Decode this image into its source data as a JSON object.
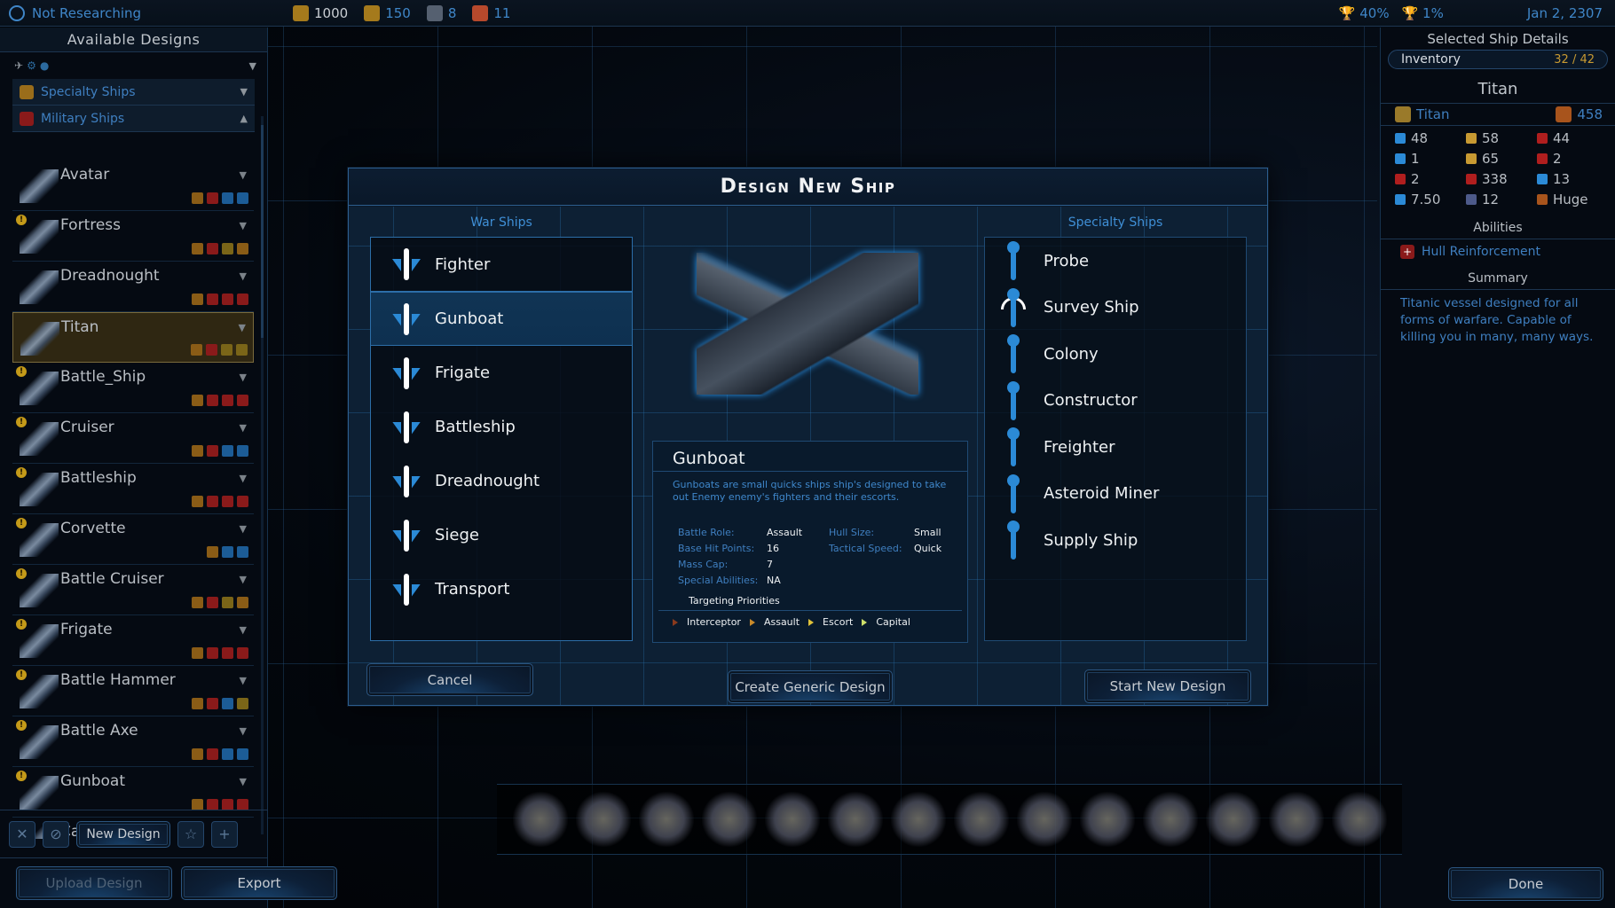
{
  "topbar": {
    "research_status": "Not Researching",
    "resources": [
      {
        "icon": "credits-icon",
        "value": "1000",
        "color": "#a57a1c"
      },
      {
        "icon": "influence-icon",
        "value": "150",
        "color": "#a57a1c"
      },
      {
        "icon": "food-icon",
        "value": "8",
        "color": "#556070"
      },
      {
        "icon": "military-icon",
        "value": "11",
        "color": "#b7492c"
      }
    ],
    "approval": "40%",
    "victory": "1%",
    "date": "Jan 2, 2307"
  },
  "left_panel": {
    "title": "Available Designs",
    "categories": [
      {
        "label": "Specialty Ships",
        "expanded": false
      },
      {
        "label": "Military Ships",
        "expanded": true
      }
    ],
    "designs": [
      {
        "name": "Avatar",
        "warning": false,
        "selected": false,
        "badges": [
          "o",
          "r",
          "b",
          "b"
        ]
      },
      {
        "name": "Fortress",
        "warning": true,
        "selected": false,
        "badges": [
          "o",
          "r",
          "g",
          "o"
        ]
      },
      {
        "name": "Dreadnought",
        "warning": false,
        "selected": false,
        "badges": [
          "o",
          "r",
          "r",
          "r"
        ]
      },
      {
        "name": "Titan",
        "warning": false,
        "selected": true,
        "badges": [
          "o",
          "r",
          "g",
          "g"
        ]
      },
      {
        "name": "Battle_Ship",
        "warning": true,
        "selected": false,
        "badges": [
          "o",
          "r",
          "r",
          "r"
        ]
      },
      {
        "name": "Cruiser",
        "warning": true,
        "selected": false,
        "badges": [
          "o",
          "r",
          "b",
          "b"
        ]
      },
      {
        "name": "Battleship",
        "warning": true,
        "selected": false,
        "badges": [
          "o",
          "r",
          "r",
          "r"
        ]
      },
      {
        "name": "Corvette",
        "warning": true,
        "selected": false,
        "badges": [
          "o",
          "b",
          "b"
        ]
      },
      {
        "name": "Battle Cruiser",
        "warning": true,
        "selected": false,
        "badges": [
          "o",
          "r",
          "g",
          "o"
        ]
      },
      {
        "name": "Frigate",
        "warning": true,
        "selected": false,
        "badges": [
          "o",
          "r",
          "r",
          "r"
        ]
      },
      {
        "name": "Battle Hammer",
        "warning": true,
        "selected": false,
        "badges": [
          "o",
          "r",
          "b",
          "g"
        ]
      },
      {
        "name": "Battle Axe",
        "warning": true,
        "selected": false,
        "badges": [
          "o",
          "r",
          "b",
          "b"
        ]
      },
      {
        "name": "Gunboat",
        "warning": true,
        "selected": false,
        "badges": [
          "o",
          "r",
          "r",
          "r"
        ]
      },
      {
        "name": "Caretaker",
        "warning": true,
        "selected": false,
        "badges": []
      }
    ],
    "new_design_label": "New Design",
    "upload_label": "Upload Design",
    "export_label": "Export"
  },
  "right_panel": {
    "title": "Selected Ship Details",
    "inventory_label": "Inventory",
    "inventory_value": "32 / 42",
    "ship_name": "Titan",
    "hull_class": "Titan",
    "hull_cost": "458",
    "stats": [
      {
        "icon": "beam-weapon-icon",
        "value": "48",
        "color": "#2b8ad6"
      },
      {
        "icon": "kinetic-weapon-icon",
        "value": "58",
        "color": "#c89a32"
      },
      {
        "icon": "missile-weapon-icon",
        "value": "44",
        "color": "#b01e1e"
      },
      {
        "icon": "shield-icon",
        "value": "1",
        "color": "#2b8ad6"
      },
      {
        "icon": "point-defense-icon",
        "value": "65",
        "color": "#c89a32"
      },
      {
        "icon": "armor-icon",
        "value": "2",
        "color": "#b01e1e"
      },
      {
        "icon": "repair-icon",
        "value": "2",
        "color": "#b01e1e"
      },
      {
        "icon": "hit-points-icon",
        "value": "338",
        "color": "#b01e1e"
      },
      {
        "icon": "speed-icon",
        "value": "13",
        "color": "#2b8ad6"
      },
      {
        "icon": "sensor-icon",
        "value": "7.50",
        "color": "#2b8ad6"
      },
      {
        "icon": "range-icon",
        "value": "12",
        "color": "#4d5a8a"
      },
      {
        "icon": "hull-size-icon",
        "value": "Huge",
        "color": "#a8541c"
      }
    ],
    "abilities_title": "Abilities",
    "abilities": [
      "Hull Reinforcement"
    ],
    "summary_title": "Summary",
    "summary": "Titanic vessel designed for all forms of warfare. Capable of killing you in many, many ways."
  },
  "hangar": {
    "count": 14
  },
  "done_label": "Done",
  "modal": {
    "title": "Design New Ship",
    "war_ships_title": "War Ships",
    "war_ships": [
      "Fighter",
      "Gunboat",
      "Frigate",
      "Battleship",
      "Dreadnought",
      "Siege",
      "Transport"
    ],
    "selected_war_ship": "Gunboat",
    "specialty_title": "Specialty Ships",
    "specialty_ships": [
      "Probe",
      "Survey Ship",
      "Colony",
      "Constructor",
      "Freighter",
      "Asteroid Miner",
      "Supply Ship"
    ],
    "info": {
      "name": "Gunboat",
      "description": "Gunboats are small quicks ships ship's designed to take out Enemy enemy's fighters and their escorts.",
      "fields": [
        {
          "label": "Battle Role:",
          "value": "Assault"
        },
        {
          "label": "Hull Size:",
          "value": "Small"
        },
        {
          "label": "Base Hit Points:",
          "value": "16"
        },
        {
          "label": "Tactical Speed:",
          "value": "Quick"
        },
        {
          "label": "Mass Cap:",
          "value": "7"
        },
        {
          "label": "",
          "value": ""
        },
        {
          "label": "Special Abilities:",
          "value": "NA"
        },
        {
          "label": "",
          "value": ""
        }
      ],
      "targeting_title": "Targeting Priorities",
      "targeting": [
        "Interceptor",
        "Assault",
        "Escort",
        "Capital"
      ]
    },
    "cancel_label": "Cancel",
    "generic_label": "Create Generic Design",
    "start_label": "Start New Design"
  }
}
